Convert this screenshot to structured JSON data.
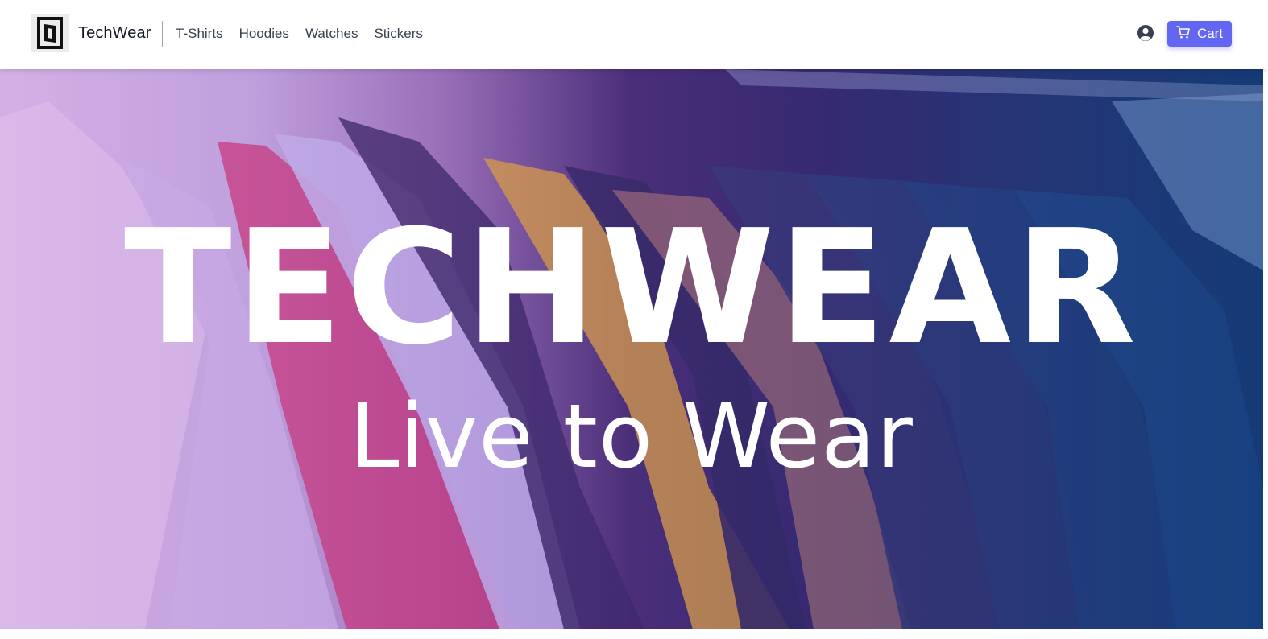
{
  "brand": {
    "name": "TechWear",
    "logo_icon": "techwear-logo-icon"
  },
  "nav": {
    "links": [
      {
        "label": "T-Shirts"
      },
      {
        "label": "Hoodies"
      },
      {
        "label": "Watches"
      },
      {
        "label": "Stickers"
      }
    ]
  },
  "header_actions": {
    "account_icon": "user-circle-icon",
    "cart_icon": "shopping-cart-icon",
    "cart_label": "Cart"
  },
  "hero": {
    "title": "TECHWEAR",
    "subtitle": "Live to Wear"
  },
  "colors": {
    "accent": "#6366f1",
    "text": "#111827",
    "nav_text": "#374151"
  }
}
